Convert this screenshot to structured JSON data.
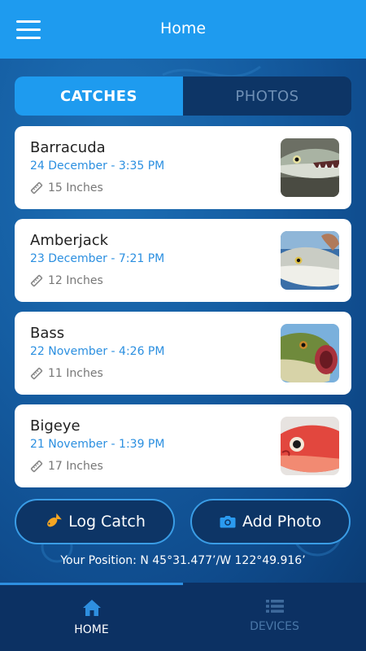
{
  "header": {
    "title": "Home",
    "menu_icon": "hamburger-menu-icon"
  },
  "tabs": [
    {
      "label": "CATCHES",
      "active": true
    },
    {
      "label": "PHOTOS",
      "active": false
    }
  ],
  "catches": [
    {
      "name": "Barracuda",
      "date": "24 December - 3:35 PM",
      "size": "15 Inches",
      "thumb": "barracuda-photo"
    },
    {
      "name": "Amberjack",
      "date": "23 December - 7:21 PM",
      "size": "12 Inches",
      "thumb": "amberjack-photo"
    },
    {
      "name": "Bass",
      "date": "22 November - 4:26 PM",
      "size": "11 Inches",
      "thumb": "bass-photo"
    },
    {
      "name": "Bigeye",
      "date": "21 November - 1:39 PM",
      "size": "17 Inches",
      "thumb": "bigeye-photo"
    }
  ],
  "actions": {
    "log_catch": {
      "label": "Log Catch",
      "icon": "fish-icon",
      "icon_color": "#f5a623"
    },
    "add_photo": {
      "label": "Add Photo",
      "icon": "camera-icon",
      "icon_color": "#2b9bf0"
    }
  },
  "position_text": "Your Position: N 45°31.477’/W 122°49.916’",
  "bottom_nav": [
    {
      "label": "HOME",
      "icon": "home-icon",
      "active": true
    },
    {
      "label": "DEVICES",
      "icon": "list-icon",
      "active": false
    }
  ],
  "colors": {
    "accent": "#1e9bef",
    "navy": "#0d3566",
    "date_blue": "#2b8fe0"
  }
}
